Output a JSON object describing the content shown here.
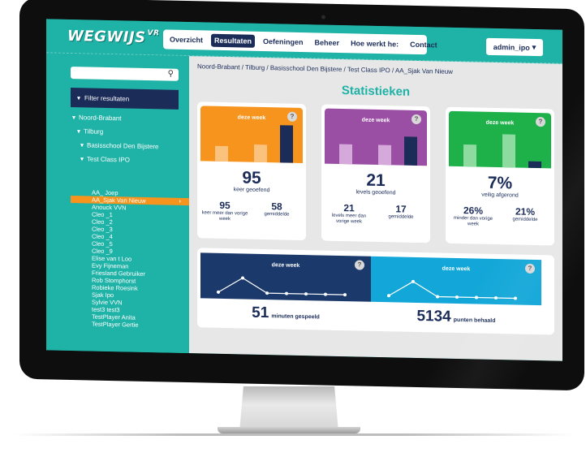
{
  "app": {
    "logo": "WEGWIJS",
    "logo_sup": "VR",
    "user_menu": "admin_ipo"
  },
  "nav": [
    {
      "label": "Overzicht"
    },
    {
      "label": "Resultaten"
    },
    {
      "label": "Oefeningen"
    },
    {
      "label": "Beheer"
    },
    {
      "label": "Hoe werkt he:"
    },
    {
      "label": "Contact"
    }
  ],
  "nav_active": "Resultaten",
  "sidebar": {
    "search_placeholder": "",
    "filter_label": "Filter resultaten",
    "tree": [
      {
        "label": "Noord-Brabant"
      },
      {
        "label": "Tilburg"
      },
      {
        "label": "Basisschool Den Bijstere"
      },
      {
        "label": "Test Class IPO"
      }
    ],
    "players": [
      "AA_ Joep",
      "AA_Sjak Van Nieuw",
      "Anouck VVN",
      "Cleo _1",
      "Cleo _2",
      "Cleo _3",
      "Cleo _4",
      "Cleo _5",
      "Cleo _9",
      "Elise van t Loo",
      "Evy Fijneman",
      "Friesland Gebruiker",
      "Rob Stomphorst",
      "Robieke Roesink",
      "Sjak Ipo",
      "Sylvie VVN",
      "test3 test3",
      "TestPlayer Anita",
      "TestPlayer Gertie"
    ],
    "selected_player": "AA_Sjak Van Nieuw"
  },
  "main": {
    "breadcrumb": "Noord-Brabant / Tilburg / Basisschool Den Bijstere / Test Class IPO / AA_Sjak Van Nieuw",
    "title": "Statistieken",
    "cards": [
      {
        "week_label": "deze week",
        "help": "?",
        "color": "#f7941d",
        "bar_light": "#fbc27d",
        "bar_dark": "#1b2c59",
        "bar_values": [
          0.28,
          0.32,
          0.68
        ],
        "value": "95",
        "value_label": "keer geoefend",
        "sub_left_value": "95",
        "sub_left_label": "keer meer dan vorige week",
        "sub_right_value": "58",
        "sub_right_label": "gemiddelde"
      },
      {
        "week_label": "deze week",
        "help": "?",
        "color": "#9b4fa4",
        "bar_light": "#d6a9db",
        "bar_dark": "#1b2c59",
        "bar_values": [
          0.36,
          0.36,
          0.52
        ],
        "value": "21",
        "value_label": "levels geoefend",
        "sub_left_value": "21",
        "sub_left_label": "levels meer dan vorige week",
        "sub_right_value": "17",
        "sub_right_label": "gemiddelde"
      },
      {
        "week_label": "deze week",
        "help": "?",
        "color": "#1eb14a",
        "bar_light": "#8edb9f",
        "bar_dark": "#1b2c59",
        "bar_values": [
          0.4,
          0.6,
          0.12
        ],
        "value": "7%",
        "value_label": "veilig afgerond",
        "sub_left_value": "26%",
        "sub_left_label": "minder dan vorige week",
        "sub_right_value": "21%",
        "sub_right_label": "gemiddelde"
      }
    ],
    "wide": {
      "left": {
        "week_label": "deze week",
        "help": "?",
        "color": "#1b3a6b",
        "value": "51",
        "label": "minuten gespeeld"
      },
      "right": {
        "week_label": "deze week",
        "help": "?",
        "color": "#12a7d8",
        "value": "5134",
        "label": "punten behaald"
      }
    }
  }
}
